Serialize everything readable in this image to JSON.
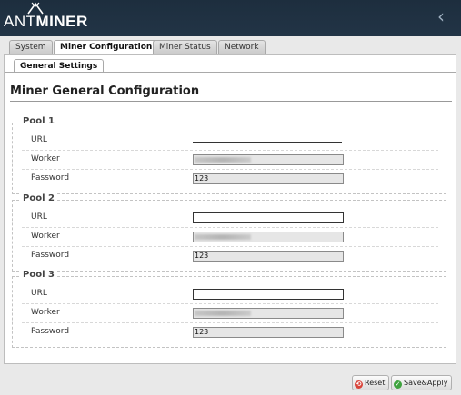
{
  "header": {
    "logo_light": "ANT",
    "logo_bold": "MINER",
    "back_glyph": "‹"
  },
  "tabs": [
    {
      "label": "System"
    },
    {
      "label": "Miner Configuration"
    },
    {
      "label": "Miner Status"
    },
    {
      "label": "Network"
    }
  ],
  "subtab": {
    "label": "General Settings"
  },
  "page_title": "Miner General Configuration",
  "field_labels": {
    "url": "URL",
    "worker": "Worker",
    "password": "Password"
  },
  "pools": [
    {
      "legend": "Pool 1",
      "url": "",
      "worker": "",
      "password": "123"
    },
    {
      "legend": "Pool 2",
      "url": "",
      "worker": "",
      "password": "123"
    },
    {
      "legend": "Pool 3",
      "url": "",
      "worker": "",
      "password": "123"
    }
  ],
  "buttons": {
    "reset": "Reset",
    "save_apply": "Save&Apply"
  },
  "colors": {
    "header_bg": "#1d2e3e",
    "reset_icon": "#d9443a",
    "save_icon": "#3fa33f"
  },
  "icons": {
    "logo": "antminer-logo-icon",
    "back": "chevron-left-icon",
    "reset": "reset-icon",
    "save": "check-icon"
  }
}
